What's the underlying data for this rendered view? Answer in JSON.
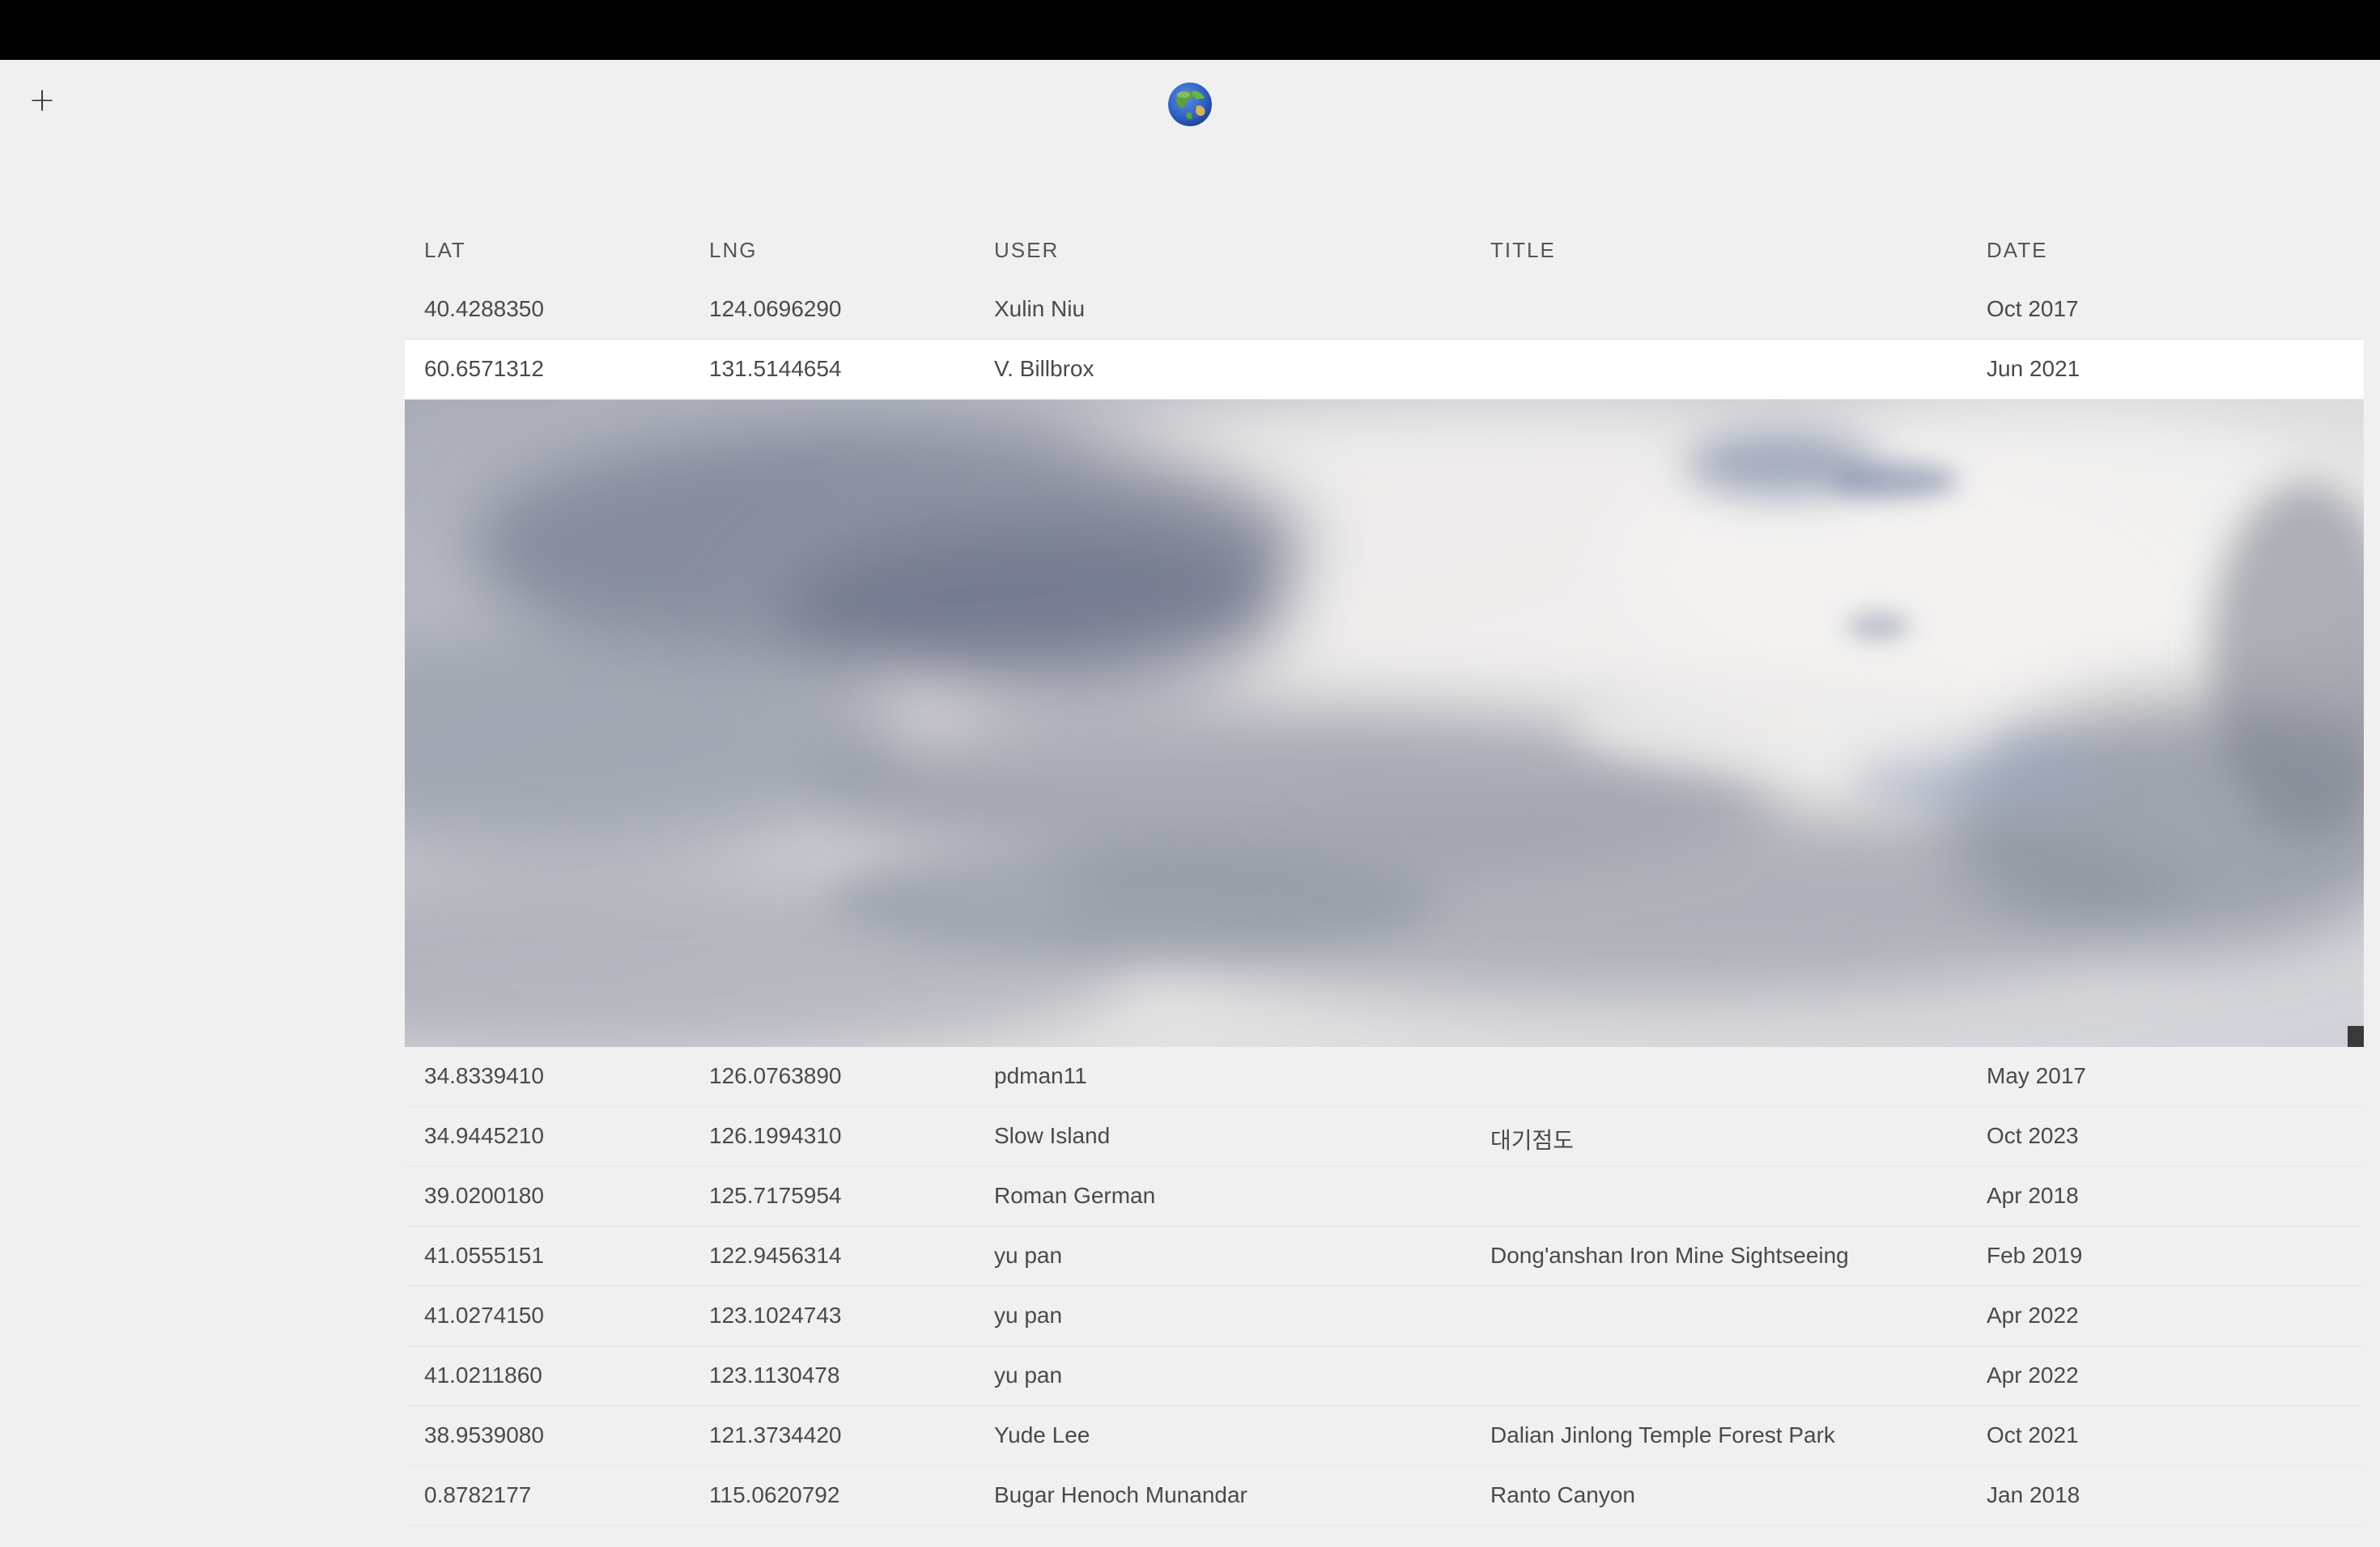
{
  "header": {
    "add_label": "+",
    "logo_icon": "globe-icon"
  },
  "table": {
    "columns": {
      "lat": "LAT",
      "lng": "LNG",
      "user": "USER",
      "title": "TITLE",
      "date": "DATE"
    },
    "rows_before": [
      {
        "lat": "40.4288350",
        "lng": "124.0696290",
        "user": "Xulin Niu",
        "title": "",
        "date": "Oct 2017"
      },
      {
        "lat": "60.6571312",
        "lng": "131.5144654",
        "user": "V. Billbrox",
        "title": "",
        "date": "Jun 2021"
      }
    ],
    "rows_after": [
      {
        "lat": "34.8339410",
        "lng": "126.0763890",
        "user": "pdman11",
        "title": "",
        "date": "May 2017"
      },
      {
        "lat": "34.9445210",
        "lng": "126.1994310",
        "user": "Slow Island",
        "title": "대기점도",
        "date": "Oct 2023"
      },
      {
        "lat": "39.0200180",
        "lng": "125.7175954",
        "user": "Roman German",
        "title": "",
        "date": "Apr 2018"
      },
      {
        "lat": "41.0555151",
        "lng": "122.9456314",
        "user": "yu pan",
        "title": "Dong'anshan Iron Mine Sightseeing",
        "date": "Feb 2019"
      },
      {
        "lat": "41.0274150",
        "lng": "123.1024743",
        "user": "yu pan",
        "title": "",
        "date": "Apr 2022"
      },
      {
        "lat": "41.0211860",
        "lng": "123.1130478",
        "user": "yu pan",
        "title": "",
        "date": "Apr 2022"
      },
      {
        "lat": "38.9539080",
        "lng": "121.3734420",
        "user": "Yude Lee",
        "title": "Dalian Jinlong Temple Forest Park",
        "date": "Oct 2021"
      },
      {
        "lat": "0.8782177",
        "lng": "115.0620792",
        "user": "Bugar Henoch Munandar",
        "title": "Ranto Canyon",
        "date": "Jan 2018"
      }
    ]
  },
  "colors": {
    "background": "#f0f0f0",
    "topbar": "#000000",
    "selected_row": "#ffffff",
    "text": "#4a4a4a"
  }
}
